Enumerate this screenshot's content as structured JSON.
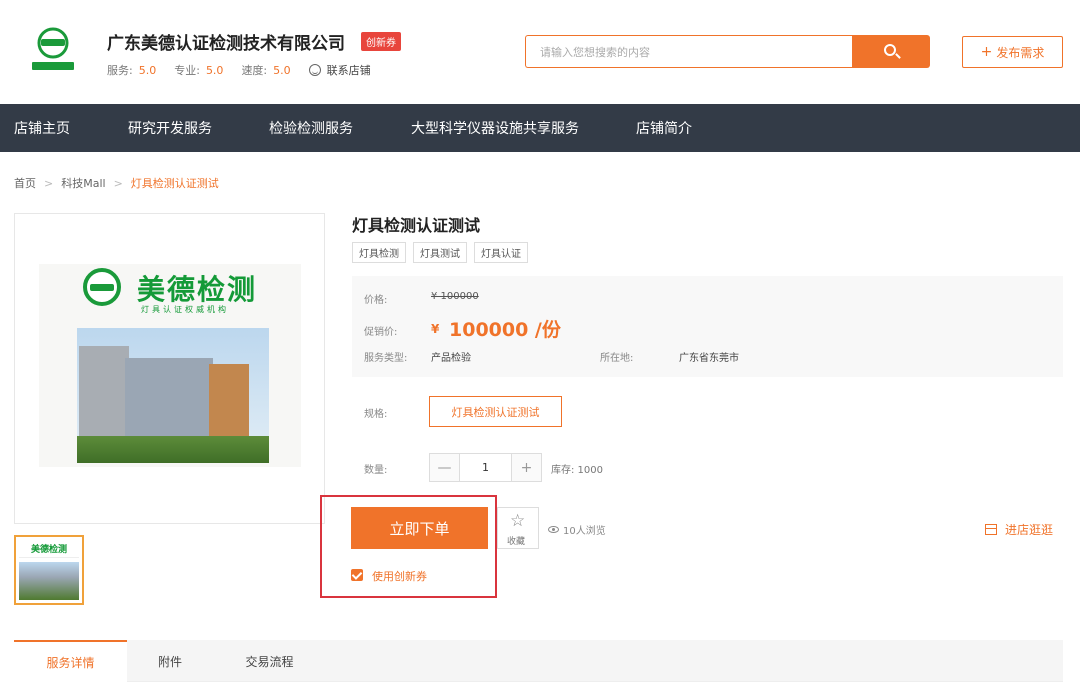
{
  "shop": {
    "name": "广东美德认证检测技术有限公司",
    "badge": "创新券",
    "logo_text": "美德检测",
    "ratings": [
      {
        "label": "服务:",
        "value": "5.0"
      },
      {
        "label": "专业:",
        "value": "5.0"
      },
      {
        "label": "速度:",
        "value": "5.0"
      }
    ],
    "contact_label": "联系店铺"
  },
  "search": {
    "placeholder": "请输入您想搜索的内容"
  },
  "publish_label": "发布需求",
  "nav": [
    "店铺主页",
    "研究开发服务",
    "检验检测服务",
    "大型科学仪器设施共享服务",
    "店铺简介"
  ],
  "breadcrumb": {
    "home": "首页",
    "mall": "科技Mall",
    "current": "灯具检测认证测试"
  },
  "gallery": {
    "brand": "美德检测",
    "brand_sub": "灯具认证权威机构",
    "thumb_logo": "美德检测"
  },
  "product": {
    "title": "灯具检测认证测试",
    "tags": [
      "灯具检测",
      "灯具测试",
      "灯具认证"
    ],
    "price_label": "价格:",
    "original_price": "¥ 100000",
    "promo_label": "促销价:",
    "currency": "¥",
    "promo_price": "100000 /份",
    "service_type_label": "服务类型:",
    "service_type": "产品检验",
    "location_label": "所在地:",
    "location": "广东省东莞市",
    "spec_label": "规格:",
    "spec_value": "灯具检测认证测试",
    "qty_label": "数量:",
    "qty_minus": "—",
    "qty": "1",
    "qty_plus": "+",
    "stock": "库存: 1000"
  },
  "actions": {
    "buy": "立即下单",
    "favorite": "收藏",
    "views": "10人浏览",
    "coupon": "使用创新券",
    "visit_shop": "进店逛逛"
  },
  "tabs": [
    "服务详情",
    "附件",
    "交易流程"
  ],
  "colors": {
    "accent": "#f0732a",
    "nav_bg": "#333b47",
    "highlight_box": "#d9343d"
  }
}
